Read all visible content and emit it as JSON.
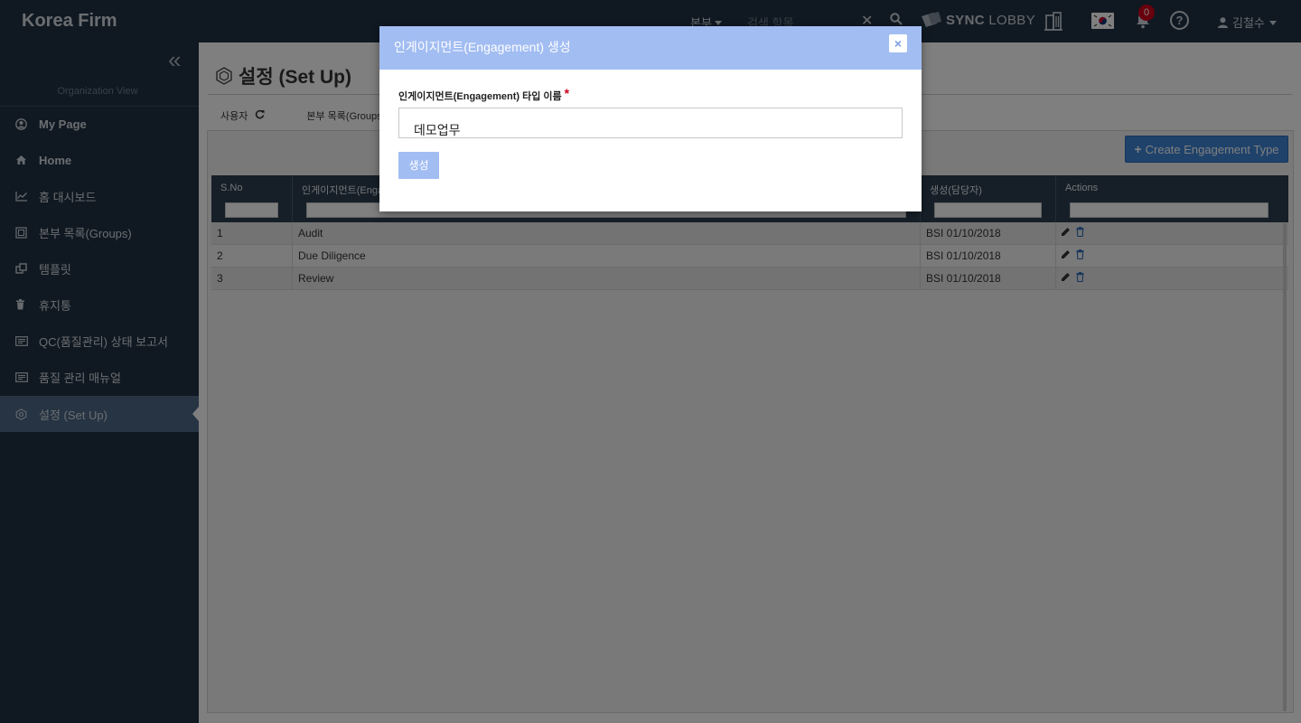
{
  "app": {
    "brand": "Korea Firm",
    "dept_menu": "본부",
    "search_placeholder": "검색 항목...",
    "sync_lobby_a": "SYNC",
    "sync_lobby_b": "LOBBY",
    "notification_count": "0",
    "help": "?",
    "user_name": "김철수"
  },
  "sidebar": {
    "org_view": "Organization View",
    "items": [
      {
        "label": "My Page",
        "icon": "user-circle-icon"
      },
      {
        "label": "Home",
        "icon": "home-icon"
      },
      {
        "label": "홈 대시보드",
        "icon": "line-chart-icon"
      },
      {
        "label": "본부 목록(Groups)",
        "icon": "groups-icon"
      },
      {
        "label": "템플릿",
        "icon": "template-icon"
      },
      {
        "label": "휴지통",
        "icon": "trash-icon"
      },
      {
        "label": "QC(품질관리) 상태 보고서",
        "icon": "report-icon"
      },
      {
        "label": "품질 관리 매뉴얼",
        "icon": "manual-icon"
      },
      {
        "label": "설정 (Set Up)",
        "icon": "setup-icon"
      }
    ]
  },
  "page": {
    "title": "설정 (Set Up)",
    "subnav_users": "사용자",
    "subnav_groups": "본부 목록(Groups)",
    "create_button": "Create Engagement Type",
    "columns": [
      "S.No",
      "인게이지먼트(Engagement) 타입 이름",
      "생성(담당자)",
      "Actions"
    ],
    "rows": [
      {
        "sno": "1",
        "name": "Audit",
        "created": "BSI 01/10/2018"
      },
      {
        "sno": "2",
        "name": "Due Diligence",
        "created": "BSI 01/10/2018"
      },
      {
        "sno": "3",
        "name": "Review",
        "created": "BSI 01/10/2018"
      }
    ]
  },
  "modal": {
    "title": "인게이지먼트(Engagement) 생성",
    "close": "×",
    "field_label": "인게이지먼트(Engagement) 타입 이름",
    "required_mark": "*",
    "field_value": "데모업무",
    "submit_label": "생성"
  },
  "colors": {
    "topbar": "#213244",
    "sidebar_active": "#4c6887",
    "table_header": "#2d3e50",
    "primary_button": "#3e85d6",
    "modal_header": "#a2bdf2",
    "badge": "#d0021b"
  }
}
